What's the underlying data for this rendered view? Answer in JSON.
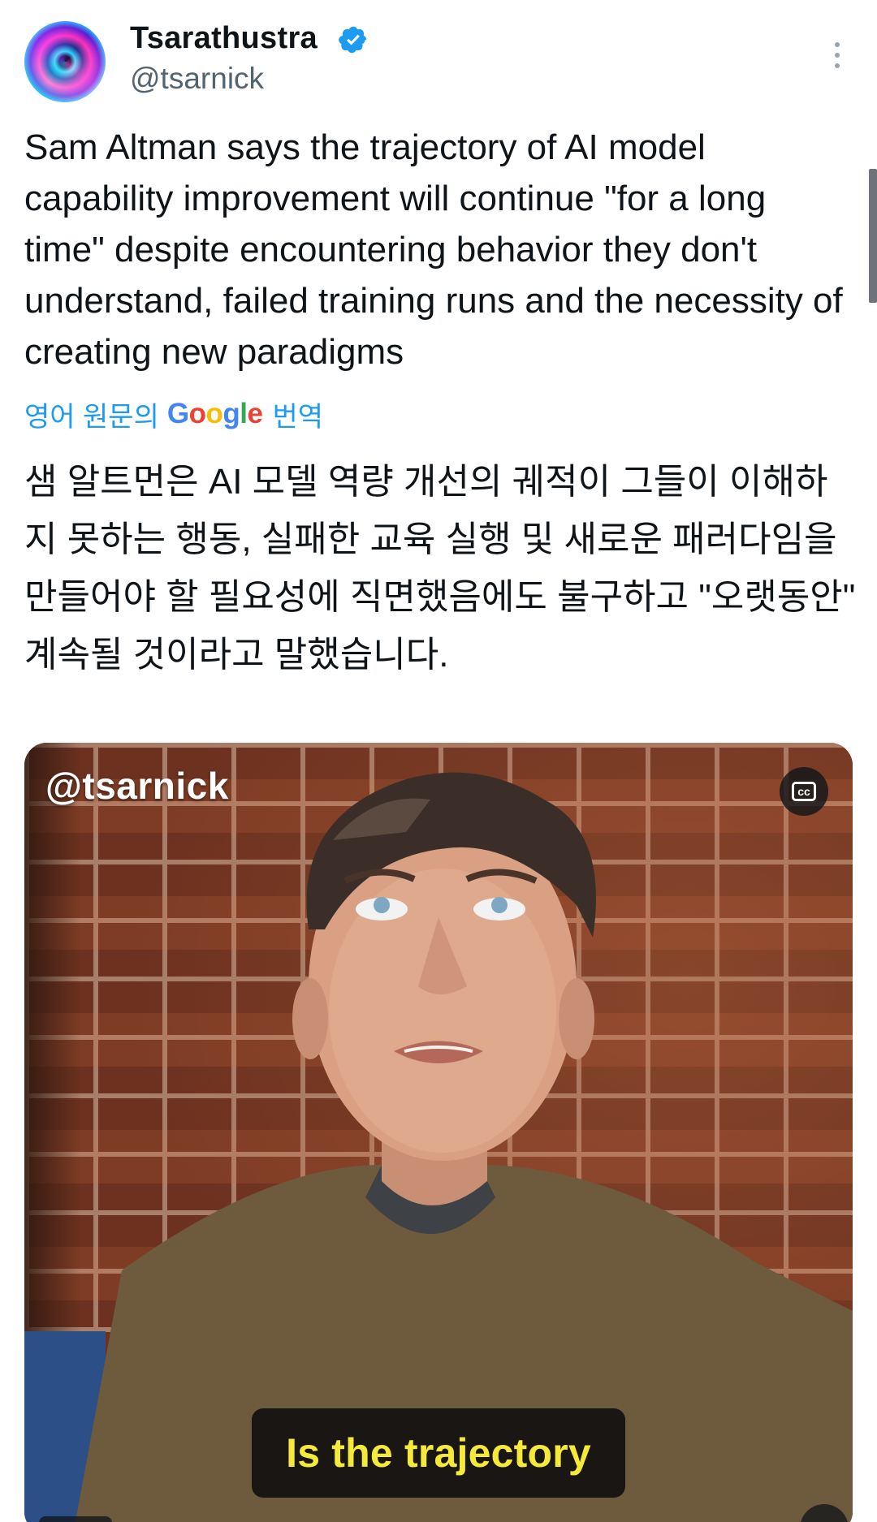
{
  "author": {
    "display_name": "Tsarathustra",
    "handle": "@tsarnick",
    "verified": true,
    "verified_color": "#1d9bf0"
  },
  "tweet": {
    "text": "Sam Altman says the trajectory of AI model capability improvement will continue \"for a long time\" despite encountering behavior they don't understand, failed training runs and the necessity of creating new paradigms",
    "translate": {
      "prefix": "영어 원문의",
      "brand": "Google",
      "suffix": "번역"
    },
    "translated_text": "샘 알트먼은 AI 모델 역량 개선의 궤적이 그들이 이해하지 못하는 행동, 실패한 교육 실행 및 새로운 패러다임을 만들어야 할 필요성에 직면했음에도 불구하고 \"오랫동안\" 계속될 것이라고 말했습니다."
  },
  "media": {
    "watermark": "@tsarnick",
    "cc_label": "cc",
    "caption": "Is the trajectory"
  },
  "icons": {
    "more": "more-vertical-icon",
    "verified": "verified-badge-icon",
    "cc": "closed-captions-icon"
  },
  "colors": {
    "link": "#1d9bf0",
    "caption_text": "#f5e93a",
    "secondary_text": "#536471"
  }
}
